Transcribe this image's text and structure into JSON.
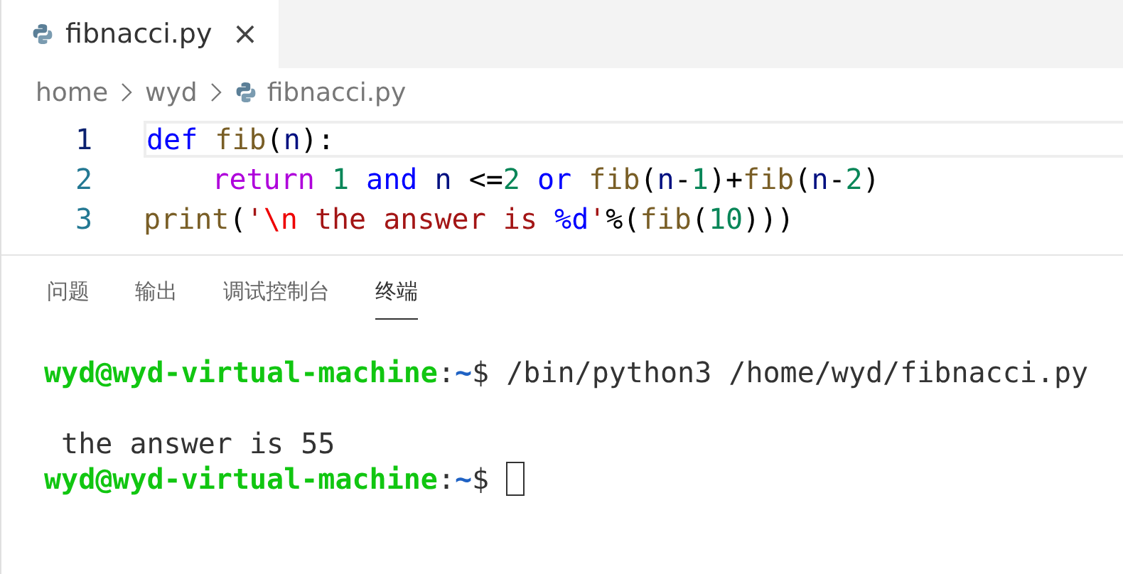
{
  "tabs": [
    {
      "label": "fibnacci.py",
      "selected": true,
      "close": "×"
    }
  ],
  "breadcrumb": [
    "home",
    "wyd",
    "fibnacci.py"
  ],
  "editor": {
    "lines": [
      {
        "number": "1",
        "current": true,
        "tokens": [
          {
            "kind": "keyword",
            "text": "def"
          },
          {
            "kind": "function",
            "text": " fib"
          },
          {
            "kind": "plain",
            "text": "("
          },
          {
            "kind": "variable",
            "text": "n"
          },
          {
            "kind": "plain",
            "text": "):"
          }
        ]
      },
      {
        "number": "2",
        "current": false,
        "tokens": [
          {
            "kind": "control",
            "text": "    return"
          },
          {
            "kind": "number",
            "text": " 1"
          },
          {
            "kind": "keyword",
            "text": " and"
          },
          {
            "kind": "variable",
            "text": " n"
          },
          {
            "kind": "plain",
            "text": " <="
          },
          {
            "kind": "number",
            "text": "2"
          },
          {
            "kind": "keyword",
            "text": " or"
          },
          {
            "kind": "function",
            "text": " fib"
          },
          {
            "kind": "plain",
            "text": "("
          },
          {
            "kind": "variable",
            "text": "n"
          },
          {
            "kind": "plain",
            "text": "-"
          },
          {
            "kind": "number",
            "text": "1"
          },
          {
            "kind": "plain",
            "text": ")+"
          },
          {
            "kind": "function",
            "text": "fib"
          },
          {
            "kind": "plain",
            "text": "("
          },
          {
            "kind": "variable",
            "text": "n"
          },
          {
            "kind": "plain",
            "text": "-"
          },
          {
            "kind": "number",
            "text": "2"
          },
          {
            "kind": "plain",
            "text": ")"
          }
        ]
      },
      {
        "number": "3",
        "current": false,
        "tokens": [
          {
            "kind": "function",
            "text": "print"
          },
          {
            "kind": "plain",
            "text": "("
          },
          {
            "kind": "string",
            "text": "'"
          },
          {
            "kind": "escape",
            "text": "\\n"
          },
          {
            "kind": "string",
            "text": " the answer is "
          },
          {
            "kind": "keyword",
            "text": "%d"
          },
          {
            "kind": "string",
            "text": "'"
          },
          {
            "kind": "plain",
            "text": "%("
          },
          {
            "kind": "function",
            "text": "fib"
          },
          {
            "kind": "plain",
            "text": "("
          },
          {
            "kind": "number",
            "text": "10"
          },
          {
            "kind": "plain",
            "text": ")))"
          }
        ]
      }
    ]
  },
  "panel_tabs": [
    {
      "label": "问题",
      "selected": false
    },
    {
      "label": "输出",
      "selected": false
    },
    {
      "label": "调试控制台",
      "selected": false
    },
    {
      "label": "终端",
      "selected": true
    }
  ],
  "terminal": {
    "lines": [
      {
        "blank_before": false,
        "parts": [
          {
            "kind": "user",
            "text": "wyd@wyd-virtual-machine"
          },
          {
            "kind": "plain",
            "text": ":"
          },
          {
            "kind": "path",
            "text": "~"
          },
          {
            "kind": "plain",
            "text": "$ /bin/python3 /home/wyd/fibnacci.py"
          }
        ]
      },
      {
        "blank_before": true,
        "parts": [
          {
            "kind": "plain",
            "text": " the answer is 55"
          }
        ]
      },
      {
        "blank_before": false,
        "parts": [
          {
            "kind": "user",
            "text": "wyd@wyd-virtual-machine"
          },
          {
            "kind": "plain",
            "text": ":"
          },
          {
            "kind": "path",
            "text": "~"
          },
          {
            "kind": "plain",
            "text": "$"
          },
          {
            "kind": "cursor"
          }
        ]
      }
    ]
  }
}
